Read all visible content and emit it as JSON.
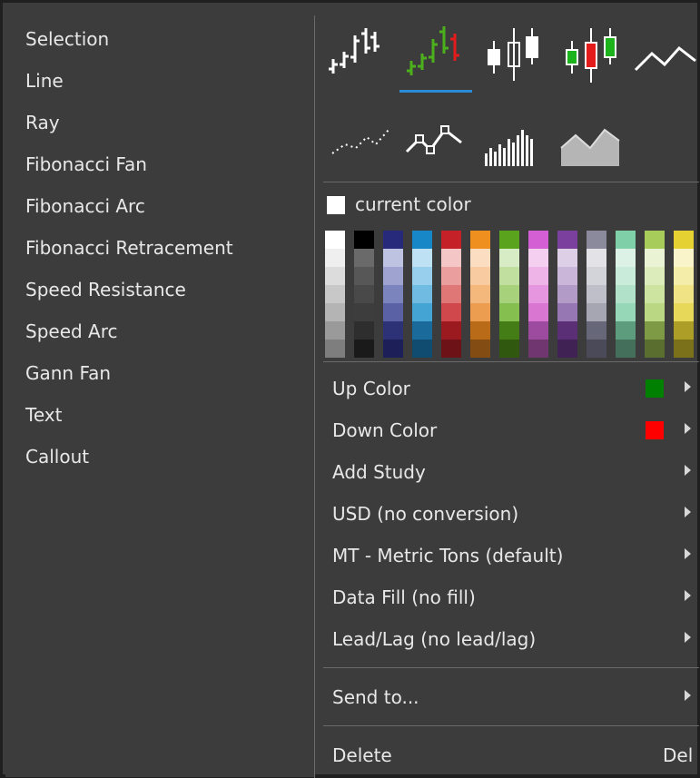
{
  "drawing_tools": [
    "Selection",
    "Line",
    "Ray",
    "Fibonacci Fan",
    "Fibonacci Arc",
    "Fibonacci Retracement",
    "Speed Resistance",
    "Speed Arc",
    "Gann Fan",
    "Text",
    "Callout"
  ],
  "chart_styles": [
    {
      "icon": "bar-ohlc-icon"
    },
    {
      "icon": "bar-ohlc-colored-icon",
      "selected": true
    },
    {
      "icon": "candlestick-icon"
    },
    {
      "icon": "candlestick-colored-icon"
    },
    {
      "icon": "line-chart-icon"
    },
    {
      "icon": "dotted-line-chart-icon"
    },
    {
      "icon": "line-with-markers-icon"
    },
    {
      "icon": "histogram-icon"
    },
    {
      "icon": "area-chart-icon"
    }
  ],
  "current_color": {
    "label": "current color",
    "value": "#ffffff"
  },
  "palette": [
    [
      "#ffffff",
      "#efefef",
      "#dcdcdc",
      "#c8c8c8",
      "#b4b4b4",
      "#9a9a9a",
      "#7e7e7e"
    ],
    [
      "#000000",
      "#6a6a6a",
      "#575757",
      "#494949",
      "#3d3d3d",
      "#2e2e2e",
      "#1a1a1a"
    ],
    [
      "#272a7a",
      "#bfc3e2",
      "#9ea3cf",
      "#7c84bd",
      "#5a62a5",
      "#2d3176",
      "#1c1f58"
    ],
    [
      "#1787c7",
      "#bfe1f4",
      "#97cfec",
      "#6fbbe1",
      "#44a4d4",
      "#1a6b9c",
      "#104c70"
    ],
    [
      "#c42129",
      "#f4c6c5",
      "#eb9e9e",
      "#e07777",
      "#d0484b",
      "#9a1a20",
      "#6d1216"
    ],
    [
      "#ef8f1f",
      "#fbdec2",
      "#f8cba0",
      "#f4b77c",
      "#ec9d4f",
      "#b96b18",
      "#834c12"
    ],
    [
      "#5aa31d",
      "#d7ebc4",
      "#c1df9f",
      "#a7d27b",
      "#84bf4f",
      "#447c15",
      "#30580f"
    ],
    [
      "#d45fd4",
      "#f4cff0",
      "#eeb4e8",
      "#e596de",
      "#d876d1",
      "#9d4b9e",
      "#6f3670"
    ],
    [
      "#7b3f9d",
      "#ddd0e6",
      "#c9b6d8",
      "#b39bc8",
      "#9677b3",
      "#5b2f76",
      "#412255"
    ],
    [
      "#8a8a9c",
      "#e3e3e7",
      "#d3d3da",
      "#bfbfc9",
      "#a6a6b3",
      "#67677a",
      "#4a4a58"
    ],
    [
      "#7fd0a8",
      "#ddf2e7",
      "#c9ebd9",
      "#b1e1c9",
      "#95d7b6",
      "#5e9c7e",
      "#44705b"
    ],
    [
      "#a8cc5a",
      "#eaf3d4",
      "#dcecbb",
      "#cde3a0",
      "#bad883",
      "#7e9a44",
      "#5a6e30"
    ],
    [
      "#e5d232",
      "#f9f4c9",
      "#f4eca9",
      "#efe385",
      "#e8d85a",
      "#ac9e26",
      "#7b711b"
    ]
  ],
  "context_menu": [
    {
      "label": "Up Color",
      "swatch": "#008000",
      "submenu": true
    },
    {
      "label": "Down Color",
      "swatch": "#ff0000",
      "submenu": true
    },
    {
      "label": "Add Study",
      "submenu": true
    },
    {
      "label": "USD (no conversion)",
      "submenu": true
    },
    {
      "label": "MT - Metric Tons (default)",
      "submenu": true
    },
    {
      "label": "Data Fill (no fill)",
      "submenu": true
    },
    {
      "label": "Lead/Lag (no lead/lag)",
      "submenu": true
    },
    {
      "label": "Send to...",
      "submenu": true
    },
    {
      "label": "Delete",
      "shortcut": "Del",
      "submenu": false
    }
  ]
}
